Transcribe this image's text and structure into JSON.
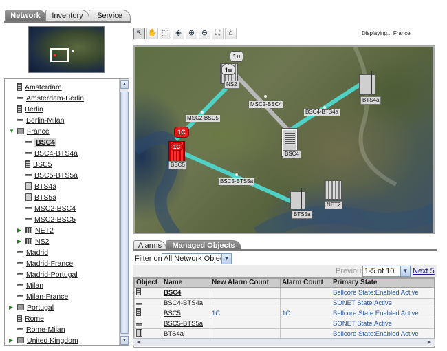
{
  "top_tabs": [
    {
      "label": "Network",
      "active": true
    },
    {
      "label": "Inventory",
      "active": false
    },
    {
      "label": "Service",
      "active": false
    }
  ],
  "tree": {
    "items": [
      {
        "label": "Amsterdam",
        "icon": "node-icon",
        "depth": 1,
        "expander": ""
      },
      {
        "label": "Amsterdam-Berlin",
        "icon": "link-icon",
        "depth": 1,
        "expander": ""
      },
      {
        "label": "Berlin",
        "icon": "node-icon",
        "depth": 1,
        "expander": ""
      },
      {
        "label": "Berlin-Milan",
        "icon": "link-icon",
        "depth": 1,
        "expander": ""
      },
      {
        "label": "France",
        "icon": "folder-icon",
        "depth": 1,
        "expander": "▼"
      },
      {
        "label": "BSC4",
        "icon": "link-icon",
        "depth": 2,
        "expander": "",
        "selected": true
      },
      {
        "label": "BSC4-BTS4a",
        "icon": "link-icon",
        "depth": 2,
        "expander": ""
      },
      {
        "label": "BSC5",
        "icon": "node-icon",
        "depth": 2,
        "expander": ""
      },
      {
        "label": "BSC5-BTS5a",
        "icon": "link-icon",
        "depth": 2,
        "expander": ""
      },
      {
        "label": "BTS4a",
        "icon": "bts-icon",
        "depth": 2,
        "expander": ""
      },
      {
        "label": "BTS5a",
        "icon": "bts-icon",
        "depth": 2,
        "expander": ""
      },
      {
        "label": "MSC2-BSC4",
        "icon": "link-icon",
        "depth": 2,
        "expander": ""
      },
      {
        "label": "MSC2-BSC5",
        "icon": "link-icon",
        "depth": 2,
        "expander": ""
      },
      {
        "label": "NET2",
        "icon": "rack-icon",
        "depth": 2,
        "expander": "▶"
      },
      {
        "label": "NS2",
        "icon": "rack-icon",
        "depth": 2,
        "expander": "▶"
      },
      {
        "label": "Madrid",
        "icon": "link-icon",
        "depth": 1,
        "expander": ""
      },
      {
        "label": "Madrid-France",
        "icon": "link-icon",
        "depth": 1,
        "expander": ""
      },
      {
        "label": "Madrid-Portugal",
        "icon": "link-icon",
        "depth": 1,
        "expander": ""
      },
      {
        "label": "Milan",
        "icon": "link-icon",
        "depth": 1,
        "expander": ""
      },
      {
        "label": "Milan-France",
        "icon": "link-icon",
        "depth": 1,
        "expander": ""
      },
      {
        "label": "Portugal",
        "icon": "folder-icon",
        "depth": 1,
        "expander": "▶"
      },
      {
        "label": "Rome",
        "icon": "node-icon",
        "depth": 1,
        "expander": ""
      },
      {
        "label": "Rome-Milan",
        "icon": "link-icon",
        "depth": 1,
        "expander": ""
      },
      {
        "label": "United Kingdom",
        "icon": "folder-icon",
        "depth": 1,
        "expander": "▶"
      }
    ]
  },
  "toolbar": {
    "tools": [
      "pointer-icon",
      "hand-pan-icon",
      "select-zoom-icon",
      "layers-icon",
      "zoom-in-icon",
      "zoom-out-icon",
      "fit-icon",
      "home-icon"
    ],
    "displaying_label": "Displaying...",
    "displaying_value": "France"
  },
  "map": {
    "nodes": {
      "ns2": "NS2",
      "bsc4": "BSC4",
      "bsc5": "BSC5",
      "bts4a": "BTS4a",
      "bts5a": "BTS5a",
      "net2": "NET2"
    },
    "links": {
      "msc2_bsc5": "MSC2-BSC5",
      "msc2_bsc4": "MSC2-BSC4",
      "bsc4_bts4a": "BSC4-BTS4a",
      "bsc5_bts5a": "BSC5-BTS5a"
    },
    "alarm_badges": {
      "ns2": "1u",
      "bsc5": "1C"
    },
    "colors": {
      "link_active": "#4fd1c5",
      "link_inactive": "#b9b9b9",
      "alarm_critical": "#e31b1b",
      "alarm_minor": "#555555"
    }
  },
  "bottom_tabs": [
    {
      "label": "Alarms",
      "active": false
    },
    {
      "label": "Managed Objects",
      "active": true
    }
  ],
  "filter": {
    "label": "Filter on",
    "value": "All Network Objects"
  },
  "pager": {
    "previous": "Previous",
    "range": "1-5 of 10",
    "next": "Next 5"
  },
  "table": {
    "columns": [
      "Object",
      "Name",
      "New Alarm Count",
      "Alarm Count",
      "Primary State"
    ],
    "rows": [
      {
        "icon": "node-icon",
        "name": "BSC4",
        "new_alarm_count": "",
        "alarm_count": "",
        "primary_state": "Bellcore State:Enabled Active"
      },
      {
        "icon": "link-icon",
        "name": "BSC4-BTS4a",
        "new_alarm_count": "",
        "alarm_count": "",
        "primary_state": "SONET State:Active"
      },
      {
        "icon": "node-icon",
        "name": "BSC5",
        "new_alarm_count": "1C",
        "alarm_count": "1C",
        "primary_state": "Bellcore State:Enabled Active"
      },
      {
        "icon": "link-icon",
        "name": "BSC5-BTS5a",
        "new_alarm_count": "",
        "alarm_count": "",
        "primary_state": "SONET State:Active"
      },
      {
        "icon": "bts-icon",
        "name": "BTS4a",
        "new_alarm_count": "",
        "alarm_count": "",
        "primary_state": "Bellcore State:Enabled Active"
      }
    ]
  }
}
